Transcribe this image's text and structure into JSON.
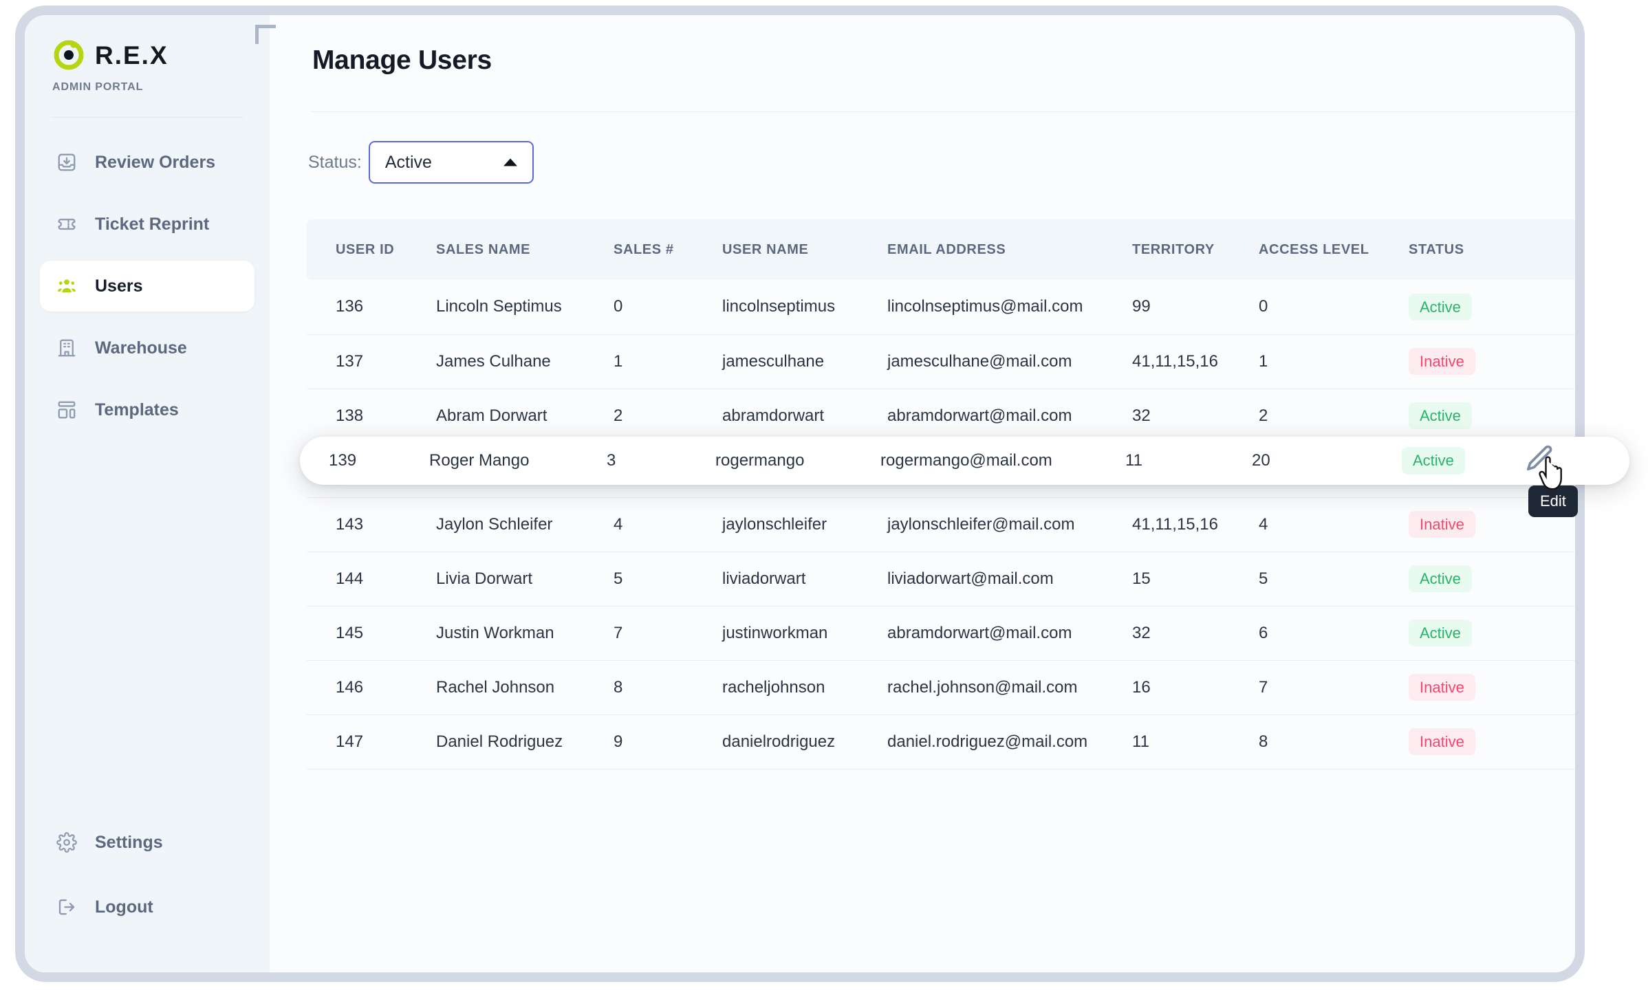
{
  "brand": {
    "wordmark": "R.E.X",
    "subtitle": "ADMIN PORTAL",
    "logo_icon": "rex-circle-logo-icon",
    "accent_color": "#b6d411"
  },
  "sidebar": {
    "items": [
      {
        "label": "Review Orders",
        "icon": "inbox-download-icon",
        "active": false
      },
      {
        "label": "Ticket Reprint",
        "icon": "ticket-icon",
        "active": false
      },
      {
        "label": "Users",
        "icon": "users-group-icon",
        "active": true
      },
      {
        "label": "Warehouse",
        "icon": "building-icon",
        "active": false
      },
      {
        "label": "Templates",
        "icon": "layout-blocks-icon",
        "active": false
      }
    ],
    "bottom_items": [
      {
        "label": "Settings",
        "icon": "gear-icon"
      },
      {
        "label": "Logout",
        "icon": "logout-arrow-icon"
      }
    ]
  },
  "header": {
    "title": "Manage Users"
  },
  "filter": {
    "label": "Status:",
    "selected": "Active",
    "caret_icon": "chevron-up-icon",
    "border_color": "#5a68e0"
  },
  "table": {
    "columns": [
      "USER ID",
      "SALES NAME",
      "SALES #",
      "USER NAME",
      "EMAIL ADDRESS",
      "TERRITORY",
      "ACCESS LEVEL",
      "STATUS"
    ],
    "rows": [
      {
        "user_id": "136",
        "sales_name": "Lincoln Septimus",
        "sales_num": "0",
        "user_name": "lincolnseptimus",
        "email": "lincolnseptimus@mail.com",
        "territory": "99",
        "access_level": "0",
        "status": "Active"
      },
      {
        "user_id": "137",
        "sales_name": "James Culhane",
        "sales_num": "1",
        "user_name": "jamesculhane",
        "email": "jamesculhane@mail.com",
        "territory": "41,11,15,16",
        "access_level": "1",
        "status": "Inative"
      },
      {
        "user_id": "138",
        "sales_name": "Abram Dorwart",
        "sales_num": "2",
        "user_name": "abramdorwart",
        "email": "abramdorwart@mail.com",
        "territory": "32",
        "access_level": "2",
        "status": "Active"
      },
      {
        "user_id": "139",
        "sales_name": "Roger Mango",
        "sales_num": "3",
        "user_name": "rogermango",
        "email": "rogermango@mail.com",
        "territory": "11",
        "access_level": "20",
        "status": "Active"
      },
      {
        "user_id": "143",
        "sales_name": "Jaylon Schleifer",
        "sales_num": "4",
        "user_name": "jaylonschleifer",
        "email": "jaylonschleifer@mail.com",
        "territory": "41,11,15,16",
        "access_level": "4",
        "status": "Inative"
      },
      {
        "user_id": "144",
        "sales_name": "Livia Dorwart",
        "sales_num": "5",
        "user_name": "liviadorwart",
        "email": "liviadorwart@mail.com",
        "territory": "15",
        "access_level": "5",
        "status": "Active"
      },
      {
        "user_id": "145",
        "sales_name": "Justin Workman",
        "sales_num": "7",
        "user_name": "justinworkman",
        "email": "abramdorwart@mail.com",
        "territory": "32",
        "access_level": "6",
        "status": "Active"
      },
      {
        "user_id": "146",
        "sales_name": "Rachel Johnson",
        "sales_num": "8",
        "user_name": "racheljohnson",
        "email": "rachel.johnson@mail.com",
        "territory": "16",
        "access_level": "7",
        "status": "Inative"
      },
      {
        "user_id": "147",
        "sales_name": "Daniel Rodriguez",
        "sales_num": "9",
        "user_name": "danielrodriguez",
        "email": "daniel.rodriguez@mail.com",
        "territory": "11",
        "access_level": "8",
        "status": "Inative"
      }
    ],
    "status_colors": {
      "active_text": "#29b36a",
      "active_bg": "#e9faf0",
      "inactive_text": "#f2486e",
      "inactive_bg": "#fdecef"
    }
  },
  "hovered_row": {
    "index": 3,
    "user_id": "139",
    "sales_name": "Roger Mango",
    "sales_num": "3",
    "user_name": "rogermango",
    "email": "rogermango@mail.com",
    "territory": "11",
    "access_level": "20",
    "status": "Active"
  },
  "row_action": {
    "icon": "pencil-edit-icon",
    "tooltip": "Edit",
    "cursor": "hand-pointer-cursor"
  }
}
